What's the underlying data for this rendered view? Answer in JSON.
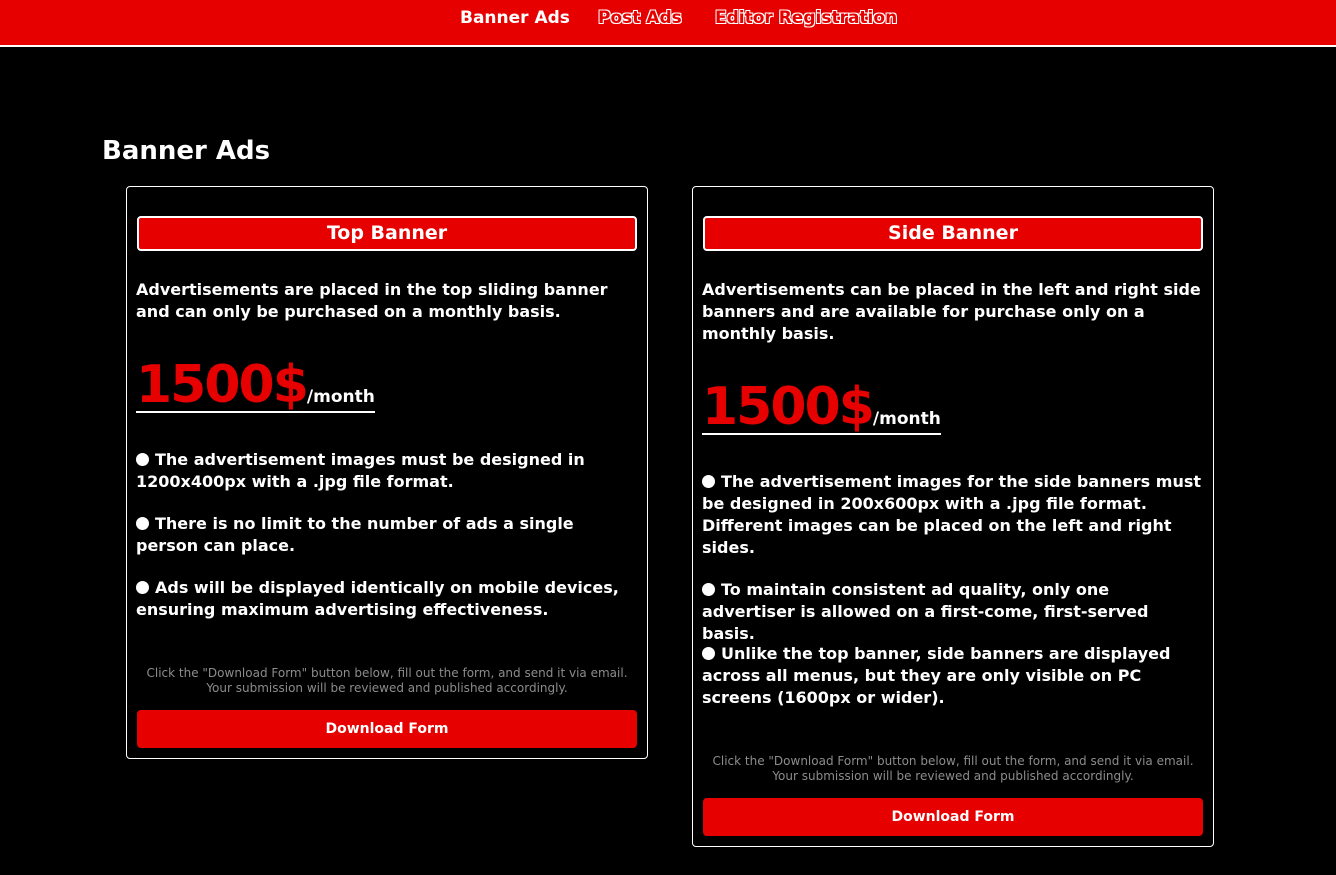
{
  "nav": {
    "items": [
      {
        "label": "Banner Ads"
      },
      {
        "label": "Post Ads"
      },
      {
        "label": "Editor Registration"
      }
    ]
  },
  "page": {
    "title": "Banner Ads"
  },
  "cards": [
    {
      "title": "Top Banner",
      "description": "Advertisements are placed in the top sliding banner and can only be purchased on a monthly basis.",
      "price": "1500$",
      "price_unit": "/month",
      "bullets": [
        "The advertisement images must be designed in 1200x400px with a .jpg file format.",
        "There is no limit to the number of ads a single person can place.",
        "Ads will be displayed identically on mobile devices, ensuring maximum advertising effectiveness."
      ],
      "note": "Click the \"Download Form\" button below, fill out the form, and send it via email. Your submission will be reviewed and published accordingly.",
      "button_label": "Download Form"
    },
    {
      "title": "Side Banner",
      "description": "Advertisements can be placed in the left and right side banners and are available for purchase only on a monthly basis.",
      "price": "1500$",
      "price_unit": "/month",
      "bullets": [
        "The advertisement images for the side banners must be designed in 200x600px with a .jpg file format. Different images can be placed on the left and right sides.",
        "To maintain consistent ad quality, only one advertiser is allowed on a first-come, first-served basis.",
        "Unlike the top banner, side banners are displayed across all menus, but they are only visible on PC screens (1600px or wider)."
      ],
      "note": "Click the \"Download Form\" button below, fill out the form, and send it via email. Your submission will be reviewed and published accordingly.",
      "button_label": "Download Form"
    }
  ],
  "colors": {
    "brand_red": "#e60000",
    "background": "#000000",
    "note_gray": "#8c8c8c"
  }
}
